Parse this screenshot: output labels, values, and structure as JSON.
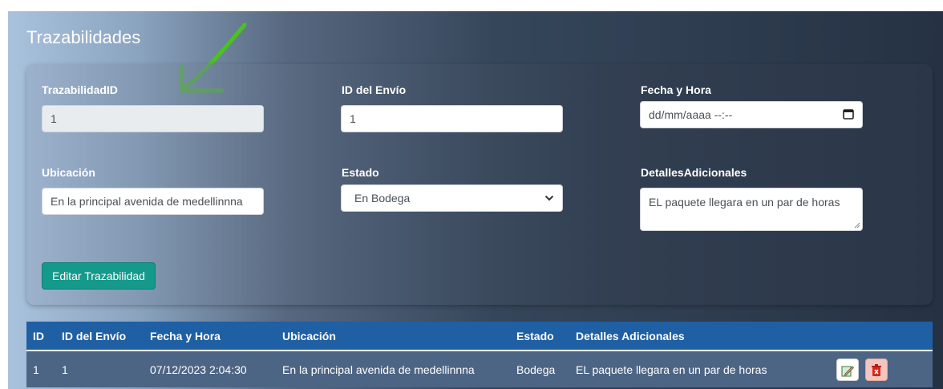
{
  "page": {
    "title": "Trazabilidades"
  },
  "form": {
    "trazabilidad_id": {
      "label": "TrazabilidadID",
      "value": "1"
    },
    "envio_id": {
      "label": "ID del Envío",
      "value": "1"
    },
    "fecha_hora": {
      "label": "Fecha y Hora",
      "placeholder": "dd/mm/aaaa --:--"
    },
    "ubicacion": {
      "label": "Ubicación",
      "value": "En la principal avenida de medellinnna"
    },
    "estado": {
      "label": "Estado",
      "value": "En Bodega"
    },
    "detalles": {
      "label": "DetallesAdicionales",
      "value": "EL paquete llegara en un par de horas"
    },
    "submit_label": "Editar Trazabilidad"
  },
  "table": {
    "headers": [
      "ID",
      "ID del Envío",
      "Fecha y Hora",
      "Ubicación",
      "Estado",
      "Detalles Adicionales",
      ""
    ],
    "rows": [
      {
        "id": "1",
        "envio": "1",
        "fecha": "07/12/2023 2:04:30",
        "ubicacion": "En la principal avenida de medellinnna",
        "estado": "Bodega",
        "detalles": "EL paquete llegara en un par de horas"
      }
    ]
  },
  "colors": {
    "accent": "#14998a",
    "table_header": "#1f5fa3",
    "annotation_arrow": "#49c41b"
  },
  "icons": {
    "edit": "edit-icon",
    "delete": "trash-icon",
    "calendar": "calendar-icon",
    "select": "chevron-down-icon"
  }
}
